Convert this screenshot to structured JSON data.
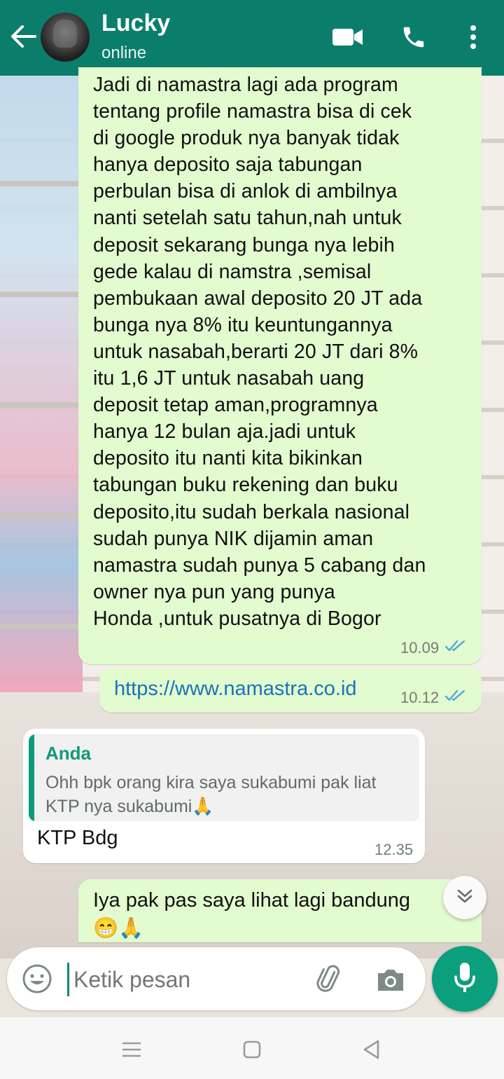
{
  "header": {
    "contact_name": "Lucky",
    "status": "online",
    "icons": [
      "back-arrow-icon",
      "video-call-icon",
      "phone-icon",
      "more-vert-icon"
    ],
    "background_color": "#0b7e6b"
  },
  "messages": [
    {
      "direction": "outgoing",
      "text": "Jadi di namastra lagi ada program\ntentang profile namastra bisa di cek\ndi google produk nya banyak tidak\nhanya deposito saja tabungan\nperbulan bisa di anlok di ambilnya\nnanti setelah satu tahun,nah untuk\ndeposit sekarang bunga nya lebih\ngede kalau di namstra ,semisal\npembukaan awal deposito 20 JT ada\nbunga nya 8% itu keuntungannya\nuntuk nasabah,berarti 20 JT dari 8%\nitu 1,6 JT untuk nasabah uang\ndeposit tetap aman,programnya\nhanya 12 bulan aja.jadi untuk\ndeposito itu nanti kita bikinkan\ntabungan buku rekening dan buku\ndeposito,itu sudah berkala nasional\nsudah punya NIK dijamin aman\nnamastra sudah punya 5 cabang dan\nowner nya pun yang punya\nHonda ,untuk pusatnya di Bogor",
      "time": "10.09",
      "status": "read"
    },
    {
      "direction": "outgoing",
      "text": "https://www.namastra.co.id",
      "time": "10.12",
      "status": "read"
    },
    {
      "direction": "incoming",
      "quote_author": "Anda",
      "quote_text": "Ohh bpk orang kira saya sukabumi pak liat KTP nya sukabumi🙏",
      "text": "KTP Bdg",
      "time": "12.35"
    },
    {
      "direction": "outgoing",
      "text": "Iya pak pas saya lihat lagi bandung\n😁🙏"
    }
  ],
  "composer": {
    "placeholder": "Ketik pesan",
    "accent_color": "#0b9f7d"
  },
  "colors": {
    "outgoing_bubble": "#e2fbcf",
    "incoming_bubble": "#ffffff",
    "read_ticks": "#4fa8e0",
    "link": "#1a73b8"
  }
}
